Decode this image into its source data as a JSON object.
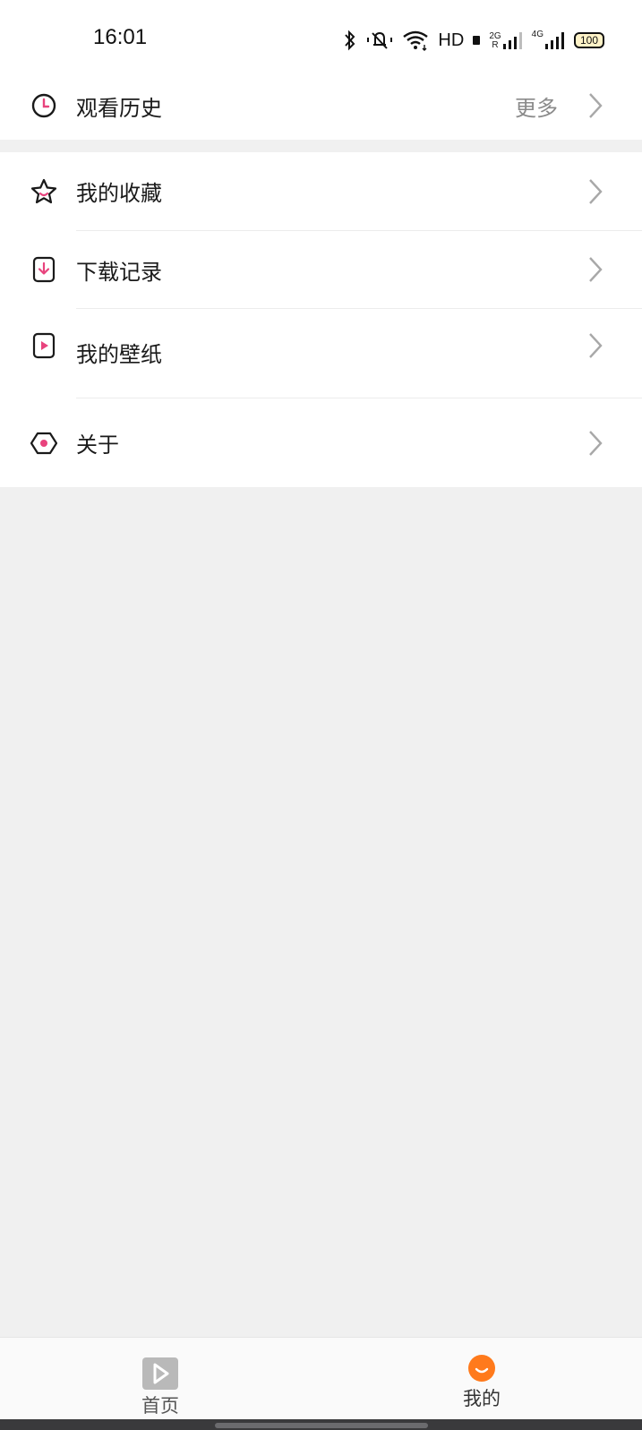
{
  "status_bar": {
    "time": "16:01",
    "hd_label": "HD",
    "sim1_network": "2G",
    "sim1_roaming": "R",
    "sim2_network": "4G",
    "battery": "100"
  },
  "history": {
    "title": "观看历史",
    "more_label": "更多",
    "icon": "clock-icon"
  },
  "menu": {
    "items": [
      {
        "label": "我的收藏",
        "icon": "star-icon"
      },
      {
        "label": "下载记录",
        "icon": "download-icon"
      },
      {
        "label": "我的壁纸",
        "icon": "play-icon"
      },
      {
        "label": "关于",
        "icon": "hexagon-icon"
      }
    ]
  },
  "tabbar": {
    "tabs": [
      {
        "label": "首页",
        "icon": "play-tab-icon",
        "active": false
      },
      {
        "label": "我的",
        "icon": "smile-icon",
        "active": true
      }
    ]
  },
  "colors": {
    "accent_pink": "#e8437d",
    "tab_active_orange": "#ff7a1c",
    "tab_inactive": "#b9b9b9"
  }
}
